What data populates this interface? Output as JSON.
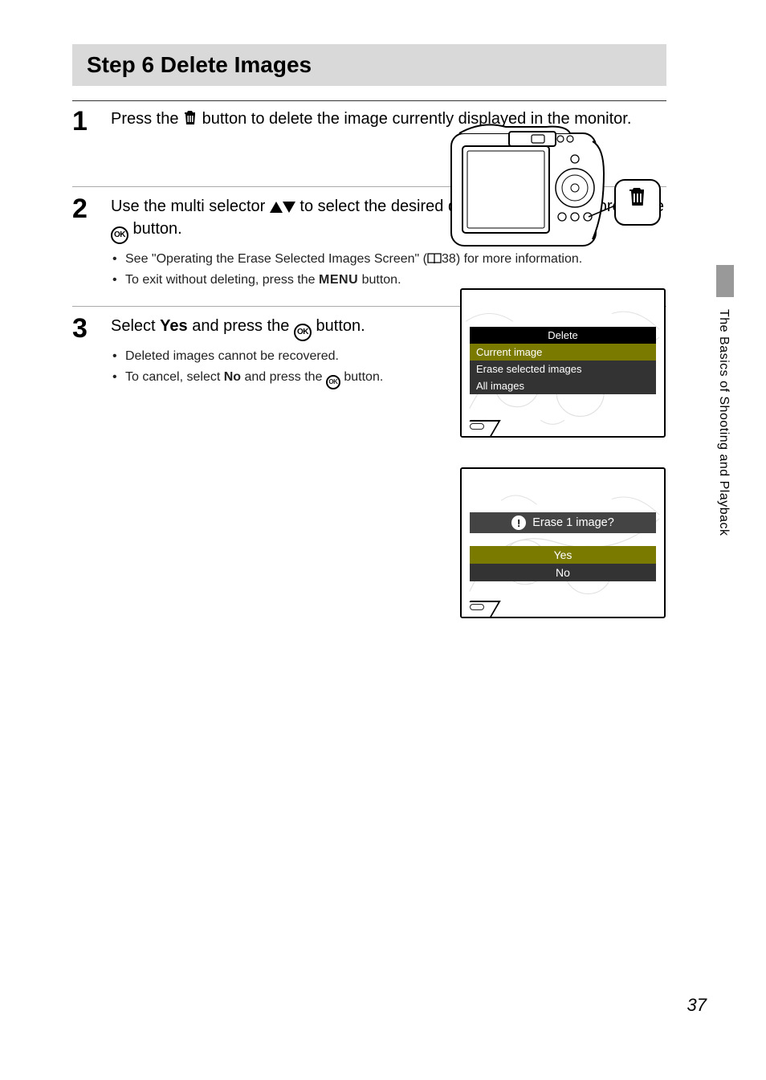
{
  "header": {
    "title": "Step 6 Delete Images"
  },
  "side": {
    "section": "The Basics of Shooting and Playback",
    "page": "37"
  },
  "steps": [
    {
      "num": "1",
      "main_pre": "Press the ",
      "main_post": " button to delete the image currently displayed in the monitor."
    },
    {
      "num": "2",
      "main_pre": "Use the multi selector ",
      "main_mid": " to select the desired deletion method and press the ",
      "main_post": " button.",
      "bullets": [
        {
          "pre": "See \"Operating the Erase Selected Images Screen\" (",
          "ref": "38",
          "post": ") for more information."
        },
        {
          "pre": "To exit without deleting, press the ",
          "label": "MENU",
          "post": " button."
        }
      ],
      "screen": {
        "title": "Delete",
        "items": [
          "Current image",
          "Erase selected images",
          "All images"
        ]
      }
    },
    {
      "num": "3",
      "main_pre": "Select ",
      "main_bold": "Yes",
      "main_mid": " and press the ",
      "main_post": " button.",
      "bullets": [
        {
          "text": "Deleted images cannot be recovered."
        },
        {
          "pre": "To cancel, select ",
          "bold": "No",
          "mid": " and press the ",
          "post": " button."
        }
      ],
      "screen": {
        "prompt": "Erase 1 image?",
        "yes": "Yes",
        "no": "No"
      }
    }
  ]
}
